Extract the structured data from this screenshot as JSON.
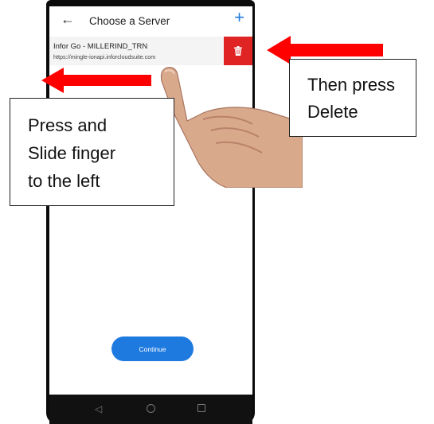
{
  "app": {
    "title": "Choose a Server",
    "back_icon": "arrow-left-icon",
    "add_icon": "plus-icon"
  },
  "server": {
    "name": "Infor Go - MILLERIND_TRN",
    "url": "https://mingle-ionapi.inforcloudsuite.com",
    "delete_icon": "trash-icon"
  },
  "continue_label": "Continue",
  "callouts": {
    "delete": [
      "Then press",
      "Delete"
    ],
    "slide": [
      "Press and",
      "Slide finger",
      "to the left"
    ]
  },
  "colors": {
    "accent": "#1f7ae0",
    "delete_red": "#e02424",
    "arrow_red": "#ff0000"
  }
}
